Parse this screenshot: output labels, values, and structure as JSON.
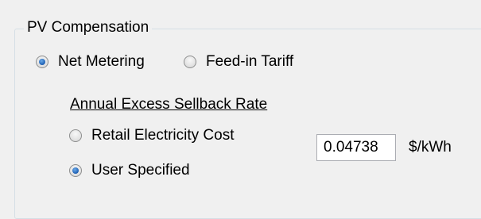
{
  "group": {
    "title": "PV Compensation"
  },
  "compensation_options": [
    {
      "label": "Net Metering",
      "checked": true
    },
    {
      "label": "Feed-in Tariff",
      "checked": false
    }
  ],
  "sellback": {
    "heading": "Annual Excess Sellback Rate",
    "options": [
      {
        "label": "Retail Electricity Cost",
        "checked": false
      },
      {
        "label": "User Specified",
        "checked": true
      }
    ],
    "value": "0.04738",
    "unit": "$/kWh"
  }
}
